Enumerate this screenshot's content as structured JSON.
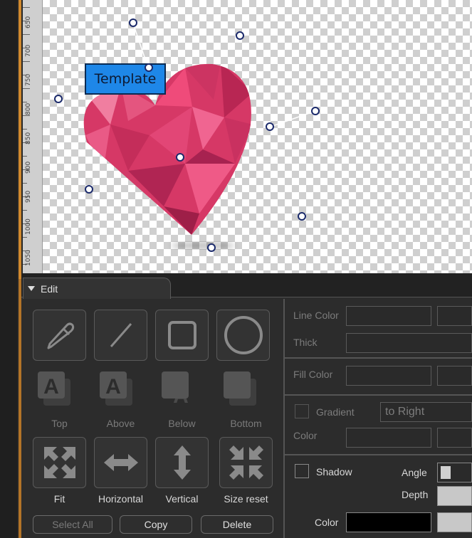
{
  "canvas": {
    "ruler_labels": [
      "650",
      "700",
      "750",
      "800",
      "850",
      "900",
      "950",
      "1000",
      "1050"
    ],
    "template_label": "Template"
  },
  "edit_panel": {
    "tab_label": "Edit",
    "draw_tools": [
      {
        "name": "pencil-tool",
        "icon": "pencil-icon"
      },
      {
        "name": "line-tool",
        "icon": "line-icon"
      },
      {
        "name": "rectangle-tool",
        "icon": "rectangle-icon"
      },
      {
        "name": "ellipse-tool",
        "icon": "circle-icon"
      }
    ],
    "order_labels": [
      "Top",
      "Above",
      "Below",
      "Bottom"
    ],
    "size_labels": [
      "Fit",
      "Horizontal",
      "Vertical",
      "Size reset"
    ],
    "select_all_label": "Select All",
    "copy_label": "Copy",
    "delete_label": "Delete"
  },
  "properties": {
    "line_color_label": "Line Color",
    "thick_label": "Thick",
    "fill_color_label": "Fill Color",
    "gradient_label": "Gradient",
    "gradient_direction": "to Right",
    "gradient_color_label": "Color",
    "shadow_label": "Shadow",
    "angle_label": "Angle",
    "depth_label": "Depth",
    "shadow_color_label": "Color",
    "shadow_color": "#000000"
  },
  "colors": {
    "accent_orange": "#d1892e",
    "selection_blue": "#1e87e8",
    "heart_pink": "#e0416f"
  }
}
